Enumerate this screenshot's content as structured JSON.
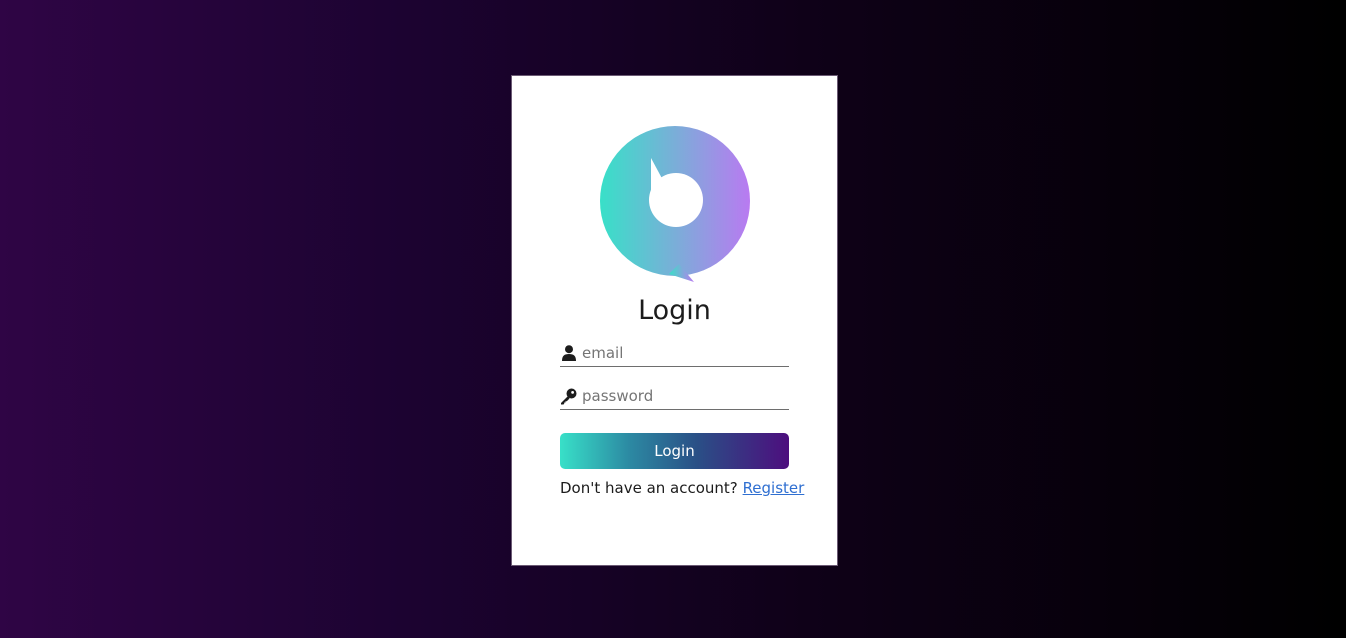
{
  "login_card": {
    "logo_icon": "chat-bubble-b-logo",
    "title": "Login",
    "email_field": {
      "icon": "user-icon",
      "value": "",
      "placeholder": "email"
    },
    "password_field": {
      "icon": "key-icon",
      "value": "",
      "placeholder": "password"
    },
    "login_button_label": "Login",
    "register_prompt": "Don't have an account?",
    "register_link": "Register"
  },
  "colors": {
    "gradient_start": "#38e0c8",
    "gradient_end": "#4d0e7e",
    "logo_gradient_start": "#38e0c8",
    "logo_gradient_end": "#b77af0",
    "link": "#2f6fd1",
    "background_dark": "#2f0545"
  }
}
